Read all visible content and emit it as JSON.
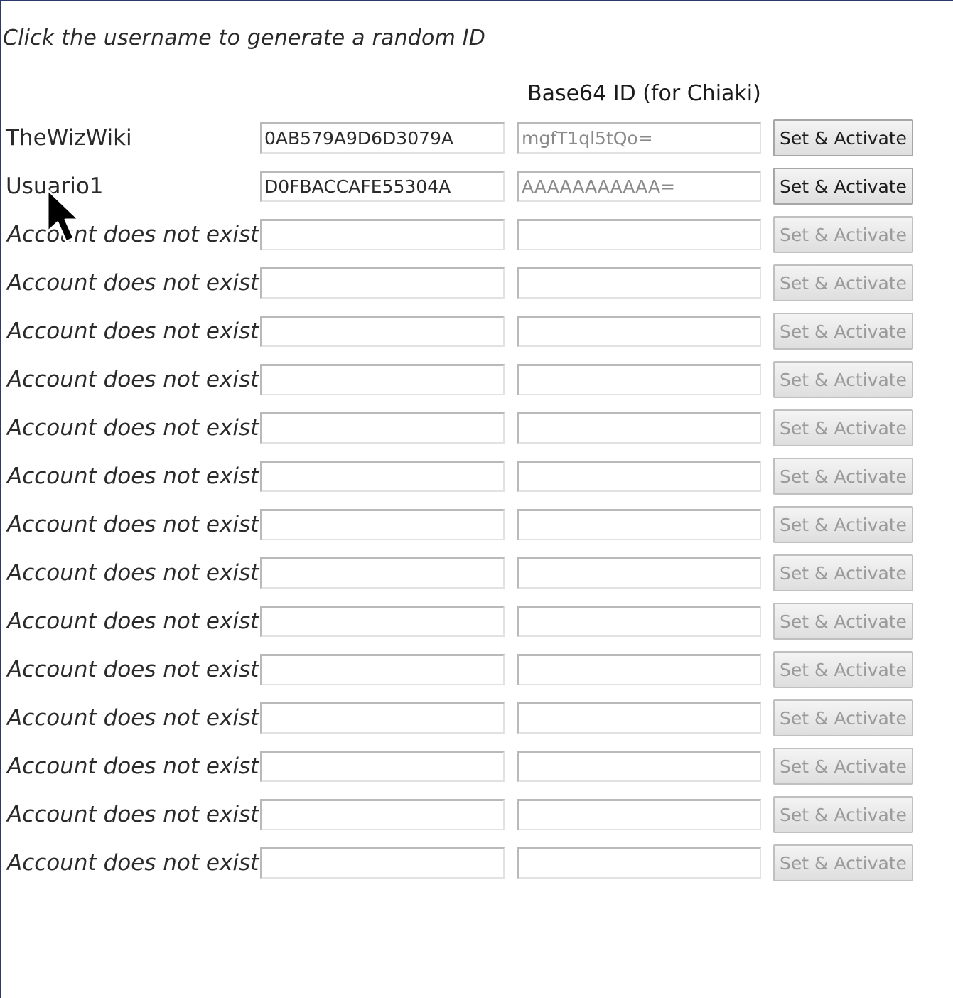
{
  "hint_text": "Click the username to generate a random ID",
  "columns": {
    "base64_header": "Base64 ID (for Chiaki)"
  },
  "accounts": [
    {
      "name": "TheWizWiki",
      "exists": true,
      "hex_id": "0AB579A9D6D3079A",
      "base64_id": "mgfT1ql5tQo=",
      "button": "Set & Activate"
    },
    {
      "name": "Usuario1",
      "exists": true,
      "hex_id": "D0FBACCAFE55304A",
      "base64_id": "AAAAAAAAAAA=",
      "button": "Set & Activate"
    },
    {
      "name": "Account does not exist",
      "exists": false,
      "hex_id": "",
      "base64_id": "",
      "button": "Set & Activate"
    },
    {
      "name": "Account does not exist",
      "exists": false,
      "hex_id": "",
      "base64_id": "",
      "button": "Set & Activate"
    },
    {
      "name": "Account does not exist",
      "exists": false,
      "hex_id": "",
      "base64_id": "",
      "button": "Set & Activate"
    },
    {
      "name": "Account does not exist",
      "exists": false,
      "hex_id": "",
      "base64_id": "",
      "button": "Set & Activate"
    },
    {
      "name": "Account does not exist",
      "exists": false,
      "hex_id": "",
      "base64_id": "",
      "button": "Set & Activate"
    },
    {
      "name": "Account does not exist",
      "exists": false,
      "hex_id": "",
      "base64_id": "",
      "button": "Set & Activate"
    },
    {
      "name": "Account does not exist",
      "exists": false,
      "hex_id": "",
      "base64_id": "",
      "button": "Set & Activate"
    },
    {
      "name": "Account does not exist",
      "exists": false,
      "hex_id": "",
      "base64_id": "",
      "button": "Set & Activate"
    },
    {
      "name": "Account does not exist",
      "exists": false,
      "hex_id": "",
      "base64_id": "",
      "button": "Set & Activate"
    },
    {
      "name": "Account does not exist",
      "exists": false,
      "hex_id": "",
      "base64_id": "",
      "button": "Set & Activate"
    },
    {
      "name": "Account does not exist",
      "exists": false,
      "hex_id": "",
      "base64_id": "",
      "button": "Set & Activate"
    },
    {
      "name": "Account does not exist",
      "exists": false,
      "hex_id": "",
      "base64_id": "",
      "button": "Set & Activate"
    },
    {
      "name": "Account does not exist",
      "exists": false,
      "hex_id": "",
      "base64_id": "",
      "button": "Set & Activate"
    },
    {
      "name": "Account does not exist",
      "exists": false,
      "hex_id": "",
      "base64_id": "",
      "button": "Set & Activate"
    }
  ],
  "cursor": {
    "icon": "mouse-pointer-icon"
  }
}
